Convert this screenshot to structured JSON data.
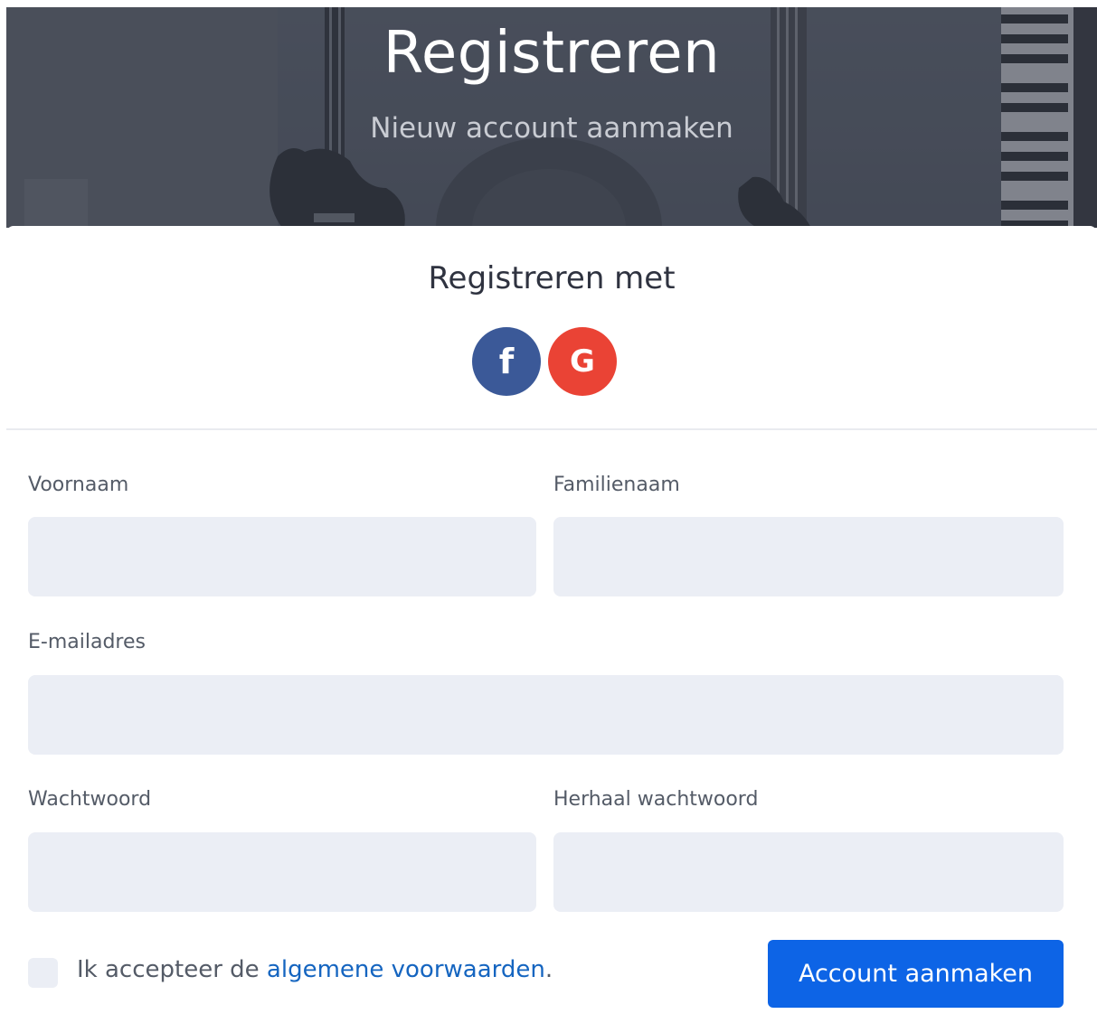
{
  "hero": {
    "title": "Registreren",
    "subtitle": "Nieuw account aanmaken"
  },
  "social": {
    "title": "Registreren met",
    "facebook_icon": "facebook-icon",
    "facebook_glyph": "f",
    "facebook_color": "#3b5998",
    "google_icon": "google-icon",
    "google_glyph": "G",
    "google_color": "#ea4335"
  },
  "form": {
    "first_name_label": "Voornaam",
    "first_name_value": "",
    "last_name_label": "Familienaam",
    "last_name_value": "",
    "email_label": "E-mailadres",
    "email_value": "",
    "password_label": "Wachtwoord",
    "password_value": "",
    "repeat_password_label": "Herhaal wachtwoord",
    "repeat_password_value": "",
    "terms_prefix": "Ik accepteer de ",
    "terms_link": "algemene voorwaarden",
    "terms_suffix": ".",
    "terms_checked": false,
    "submit_label": "Account aanmaken"
  },
  "colors": {
    "accent": "#0d64e6",
    "input_bg": "#ebeef5",
    "link": "#1565c0"
  }
}
